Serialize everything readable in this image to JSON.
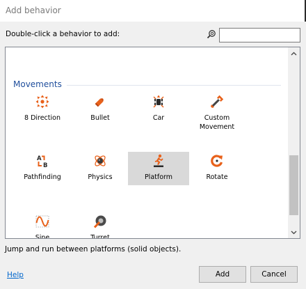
{
  "window": {
    "title": "Add behavior"
  },
  "prompt": "Double-click a behavior to add:",
  "search": {
    "value": "",
    "placeholder": ""
  },
  "groups": [
    {
      "label": "Movements"
    }
  ],
  "behaviors": [
    {
      "label": "8 Direction",
      "icon": "eight-direction-icon"
    },
    {
      "label": "Bullet",
      "icon": "bullet-icon"
    },
    {
      "label": "Car",
      "icon": "car-icon"
    },
    {
      "label": "Custom Movement",
      "icon": "wrench-icon"
    },
    {
      "label": "Pathfinding",
      "icon": "pathfinding-icon"
    },
    {
      "label": "Physics",
      "icon": "physics-icon"
    },
    {
      "label": "Platform",
      "icon": "platform-runner-icon",
      "selected": true
    },
    {
      "label": "Rotate",
      "icon": "rotate-icon"
    },
    {
      "label": "Sine",
      "icon": "sine-wave-icon"
    },
    {
      "label": "Turret",
      "icon": "turret-icon"
    }
  ],
  "description": "Jump and run between platforms (solid objects).",
  "buttons": {
    "help": "Help",
    "add": "Add",
    "cancel": "Cancel"
  },
  "colors": {
    "accent_orange": "#e8611a",
    "group_label": "#1f4e9c",
    "selection": "#d9d9d9",
    "link": "#0066cc"
  }
}
